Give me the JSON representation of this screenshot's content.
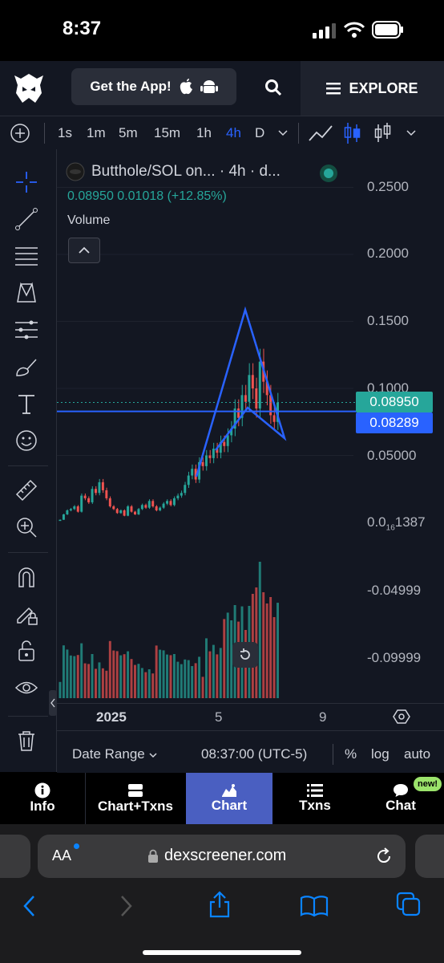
{
  "status_bar": {
    "time": "8:37"
  },
  "app_bar": {
    "get_app_label": "Get the App!",
    "explore_label": "EXPLORE"
  },
  "timeframes": {
    "items": [
      "1s",
      "1m",
      "5m",
      "15m",
      "1h",
      "4h",
      "D"
    ],
    "active": "4h"
  },
  "chart_header": {
    "title": "Butthole/SOL on... · 4h · d...",
    "price": "0.08950",
    "change": "0.01018 (+12.85%)",
    "volume_label": "Volume"
  },
  "price_axis": {
    "labels": [
      "0.2500",
      "0.2000",
      "0.1500",
      "0.1000",
      "0.05000",
      "-0.04999",
      "-0.09999"
    ],
    "zero_label_a": "0.0",
    "zero_label_sub": "16",
    "zero_label_b": "1387",
    "current_price_tag": "0.08950",
    "line_price_tag": "0.08289"
  },
  "time_axis": {
    "labels": [
      "2025",
      "5",
      "9"
    ]
  },
  "bottom_bar": {
    "date_range": "Date Range",
    "clock": "08:37:00 (UTC-5)",
    "percent": "%",
    "log": "log",
    "auto": "auto"
  },
  "bottom_nav": {
    "items": [
      {
        "label": "Info"
      },
      {
        "label": "Chart+Txns"
      },
      {
        "label": "Chart"
      },
      {
        "label": "Txns"
      },
      {
        "label": "Chat"
      }
    ],
    "active": "Chart",
    "new_badge": "new!"
  },
  "browser": {
    "text_size": "AA",
    "url": "dexscreener.com"
  },
  "colors": {
    "background": "#131722",
    "up": "#26a69a",
    "down": "#ef5350",
    "line": "#2962ff",
    "active_nav": "#4a5fc1"
  },
  "chart_data": {
    "type": "candlestick",
    "price_ticks": [
      0.25,
      0.2,
      0.15,
      0.1,
      0.05
    ],
    "last_price": 0.0895,
    "horizontal_line": 0.08289,
    "time_ticks": [
      "2025",
      "5",
      "9"
    ]
  }
}
